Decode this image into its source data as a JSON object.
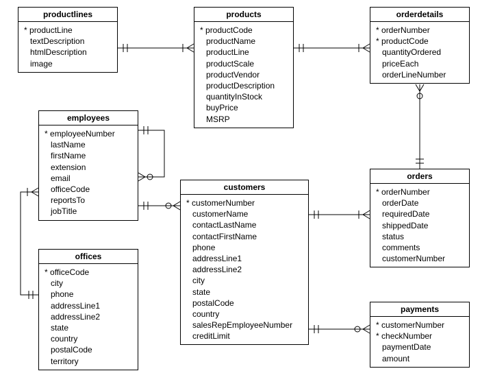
{
  "entities": {
    "productlines": {
      "title": "productlines",
      "fields": [
        {
          "name": "productLine",
          "pk": true
        },
        {
          "name": "textDescription",
          "pk": false
        },
        {
          "name": "htmlDescription",
          "pk": false
        },
        {
          "name": "image",
          "pk": false
        }
      ]
    },
    "products": {
      "title": "products",
      "fields": [
        {
          "name": "productCode",
          "pk": true
        },
        {
          "name": "productName",
          "pk": false
        },
        {
          "name": "productLine",
          "pk": false
        },
        {
          "name": "productScale",
          "pk": false
        },
        {
          "name": "productVendor",
          "pk": false
        },
        {
          "name": "productDescription",
          "pk": false
        },
        {
          "name": "quantityInStock",
          "pk": false
        },
        {
          "name": "buyPrice",
          "pk": false
        },
        {
          "name": "MSRP",
          "pk": false
        }
      ]
    },
    "orderdetails": {
      "title": "orderdetails",
      "fields": [
        {
          "name": "orderNumber",
          "pk": true
        },
        {
          "name": "productCode",
          "pk": true
        },
        {
          "name": "quantityOrdered",
          "pk": false
        },
        {
          "name": "priceEach",
          "pk": false
        },
        {
          "name": "orderLineNumber",
          "pk": false
        }
      ]
    },
    "employees": {
      "title": "employees",
      "fields": [
        {
          "name": "employeeNumber",
          "pk": true
        },
        {
          "name": "lastName",
          "pk": false
        },
        {
          "name": "firstName",
          "pk": false
        },
        {
          "name": "extension",
          "pk": false
        },
        {
          "name": "email",
          "pk": false
        },
        {
          "name": "officeCode",
          "pk": false
        },
        {
          "name": "reportsTo",
          "pk": false
        },
        {
          "name": "jobTitle",
          "pk": false
        }
      ]
    },
    "customers": {
      "title": "customers",
      "fields": [
        {
          "name": "customerNumber",
          "pk": true
        },
        {
          "name": "customerName",
          "pk": false
        },
        {
          "name": "contactLastName",
          "pk": false
        },
        {
          "name": "contactFirstName",
          "pk": false
        },
        {
          "name": "phone",
          "pk": false
        },
        {
          "name": "addressLine1",
          "pk": false
        },
        {
          "name": "addressLine2",
          "pk": false
        },
        {
          "name": "city",
          "pk": false
        },
        {
          "name": "state",
          "pk": false
        },
        {
          "name": "postalCode",
          "pk": false
        },
        {
          "name": "country",
          "pk": false
        },
        {
          "name": "salesRepEmployeeNumber",
          "pk": false
        },
        {
          "name": "creditLimit",
          "pk": false
        }
      ]
    },
    "orders": {
      "title": "orders",
      "fields": [
        {
          "name": "orderNumber",
          "pk": true
        },
        {
          "name": "orderDate",
          "pk": false
        },
        {
          "name": "requiredDate",
          "pk": false
        },
        {
          "name": "shippedDate",
          "pk": false
        },
        {
          "name": "status",
          "pk": false
        },
        {
          "name": "comments",
          "pk": false
        },
        {
          "name": "customerNumber",
          "pk": false
        }
      ]
    },
    "offices": {
      "title": "offices",
      "fields": [
        {
          "name": "officeCode",
          "pk": true
        },
        {
          "name": "city",
          "pk": false
        },
        {
          "name": "phone",
          "pk": false
        },
        {
          "name": "addressLine1",
          "pk": false
        },
        {
          "name": "addressLine2",
          "pk": false
        },
        {
          "name": "state",
          "pk": false
        },
        {
          "name": "country",
          "pk": false
        },
        {
          "name": "postalCode",
          "pk": false
        },
        {
          "name": "territory",
          "pk": false
        }
      ]
    },
    "payments": {
      "title": "payments",
      "fields": [
        {
          "name": "customerNumber",
          "pk": true
        },
        {
          "name": "checkNumber",
          "pk": true
        },
        {
          "name": "paymentDate",
          "pk": false
        },
        {
          "name": "amount",
          "pk": false
        }
      ]
    }
  },
  "relationships": [
    {
      "from": "productlines",
      "to": "products",
      "type": "one-to-many"
    },
    {
      "from": "products",
      "to": "orderdetails",
      "type": "one-to-many"
    },
    {
      "from": "orders",
      "to": "orderdetails",
      "type": "one-to-many"
    },
    {
      "from": "customers",
      "to": "orders",
      "type": "one-to-many"
    },
    {
      "from": "customers",
      "to": "payments",
      "type": "one-to-many"
    },
    {
      "from": "employees",
      "to": "customers",
      "type": "one-to-many"
    },
    {
      "from": "employees",
      "to": "employees",
      "type": "self-one-to-many"
    },
    {
      "from": "offices",
      "to": "employees",
      "type": "one-to-many"
    }
  ]
}
